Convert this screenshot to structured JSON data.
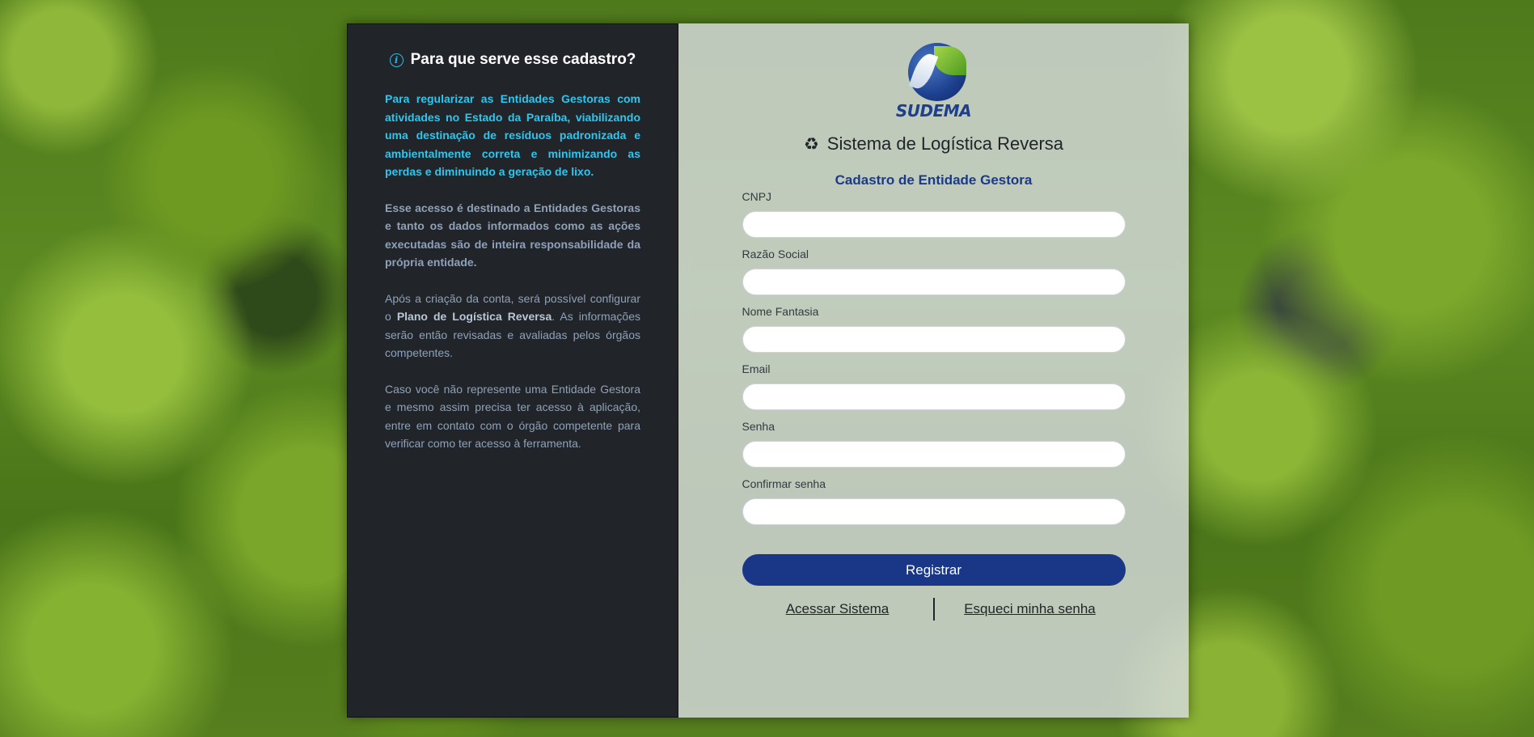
{
  "info": {
    "title": "Para que serve esse cadastro?",
    "icon": "info-circle-icon",
    "paragraph1": "Para regularizar as Entidades Gestoras com atividades no Estado da Paraíba, viabilizando uma destinação de resíduos padronizada e ambientalmente correta e minimizando as perdas e diminuindo a geração de lixo.",
    "paragraph2": "Esse acesso é destinado a Entidades Gestoras e tanto os dados informados como as ações executadas são de inteira responsabilidade da própria entidade.",
    "paragraph3_before": "Após a criação da conta, será possível configurar o ",
    "paragraph3_bold": "Plano de Logística Reversa",
    "paragraph3_after": ". As informações serão então revisadas e avaliadas pelos órgãos competentes.",
    "paragraph4": "Caso você não represente uma Entidade Gestora e mesmo assim precisa ter acesso à aplicação, entre em contato com o órgão competente para verificar como ter acesso à ferramenta."
  },
  "logo": {
    "text": "SUDEMA"
  },
  "system": {
    "icon": "recycle-icon",
    "title": "Sistema de Logística Reversa"
  },
  "form": {
    "title": "Cadastro de Entidade Gestora",
    "fields": [
      {
        "label": "CNPJ",
        "value": ""
      },
      {
        "label": "Razão Social",
        "value": ""
      },
      {
        "label": "Nome Fantasia",
        "value": ""
      },
      {
        "label": "Email",
        "value": ""
      },
      {
        "label": "Senha",
        "value": ""
      },
      {
        "label": "Confirmar senha",
        "value": ""
      }
    ],
    "submit_label": "Registrar",
    "link_login": "Acessar Sistema",
    "link_forgot": "Esqueci minha senha"
  },
  "colors": {
    "accent": "#2bc7f0",
    "primary": "#1a3686",
    "panel_dark": "#212529"
  }
}
